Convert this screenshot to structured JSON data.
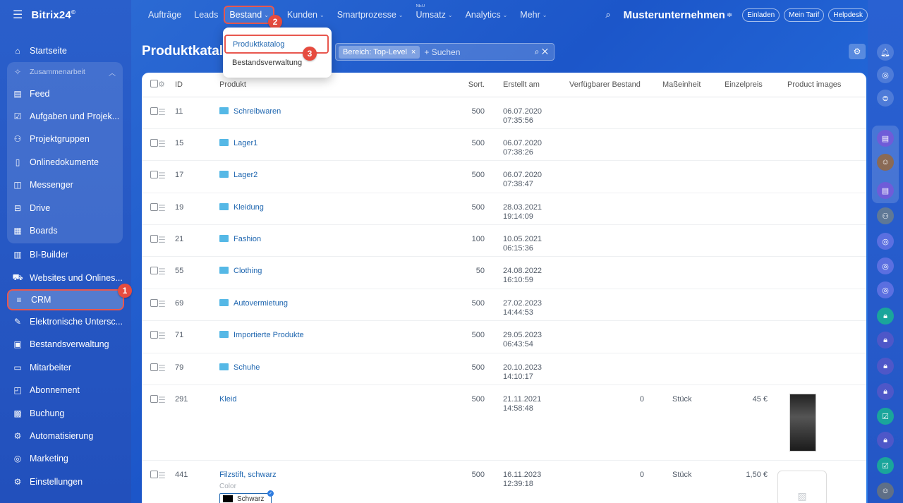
{
  "app": {
    "brand": "Bitrix24",
    "brand_mark": "©"
  },
  "topnav": {
    "tabs": [
      {
        "label": "Aufträge"
      },
      {
        "label": "Leads"
      },
      {
        "label": "Bestand",
        "chevron": "⌄"
      },
      {
        "label": "Kunden",
        "chevron": "⌄"
      },
      {
        "label": "Smartprozesse",
        "chevron": "⌄"
      },
      {
        "label": "Umsatz",
        "chevron": "⌄",
        "badge": "NEU"
      },
      {
        "label": "Analytics",
        "chevron": "⌄"
      },
      {
        "label": "Mehr",
        "chevron": "⌄"
      }
    ],
    "company": "Musterunternehmen",
    "invite": "Einladen",
    "plan": "Mein Tarif",
    "help": "Helpdesk"
  },
  "dropdown": {
    "items": [
      "Produktkatalog",
      "Bestandsverwaltung"
    ]
  },
  "markers": {
    "m1": "1",
    "m2": "2",
    "m3": "3"
  },
  "sidebar": {
    "home": "Startseite",
    "group_label": "Zusammenarbeit",
    "group_items": [
      "Feed",
      "Aufgaben und Projek...",
      "Projektgruppen",
      "Onlinedokumente",
      "Messenger",
      "Drive",
      "Boards"
    ],
    "items": [
      "BI-Builder",
      "Websites und Onlines...",
      "CRM",
      "Elektronische Untersc...",
      "Bestandsverwaltung",
      "Mitarbeiter",
      "Abonnement",
      "Buchung",
      "Automatisierung",
      "Marketing",
      "Einstellungen"
    ]
  },
  "page": {
    "title": "Produktkatalog",
    "filter_chip": "Bereich: Top-Level",
    "search_placeholder": "+ Suchen"
  },
  "table": {
    "columns": [
      "ID",
      "Produkt",
      "Sort.",
      "Erstellt am",
      "Verfügbarer Bestand",
      "Maßeinheit",
      "Einzelpreis",
      "Product images"
    ],
    "rows": [
      {
        "id": "11",
        "name": "Schreibwaren",
        "folder": true,
        "sort": "500",
        "date": "06.07.2020",
        "time": "07:35:56",
        "stock": "",
        "unit": "",
        "price": ""
      },
      {
        "id": "15",
        "name": "Lager1",
        "folder": true,
        "sort": "500",
        "date": "06.07.2020",
        "time": "07:38:26",
        "stock": "",
        "unit": "",
        "price": ""
      },
      {
        "id": "17",
        "name": "Lager2",
        "folder": true,
        "sort": "500",
        "date": "06.07.2020",
        "time": "07:38:47",
        "stock": "",
        "unit": "",
        "price": ""
      },
      {
        "id": "19",
        "name": "Kleidung",
        "folder": true,
        "sort": "500",
        "date": "28.03.2021",
        "time": "19:14:09",
        "stock": "",
        "unit": "",
        "price": ""
      },
      {
        "id": "21",
        "name": "Fashion",
        "folder": true,
        "sort": "100",
        "date": "10.05.2021",
        "time": "06:15:36",
        "stock": "",
        "unit": "",
        "price": ""
      },
      {
        "id": "55",
        "name": "Clothing",
        "folder": true,
        "sort": "50",
        "date": "24.08.2022",
        "time": "16:10:59",
        "stock": "",
        "unit": "",
        "price": ""
      },
      {
        "id": "69",
        "name": "Autovermietung",
        "folder": true,
        "sort": "500",
        "date": "27.02.2023",
        "time": "14:44:53",
        "stock": "",
        "unit": "",
        "price": ""
      },
      {
        "id": "71",
        "name": "Importierte Produkte",
        "folder": true,
        "sort": "500",
        "date": "29.05.2023",
        "time": "06:43:54",
        "stock": "",
        "unit": "",
        "price": ""
      },
      {
        "id": "79",
        "name": "Schuhe",
        "folder": true,
        "sort": "500",
        "date": "20.10.2023",
        "time": "14:10:17",
        "stock": "",
        "unit": "",
        "price": ""
      },
      {
        "id": "291",
        "name": "Kleid",
        "folder": false,
        "sort": "500",
        "date": "21.11.2021",
        "time": "14:58:48",
        "stock": "0",
        "unit": "Stück",
        "price": "45 €"
      },
      {
        "id": "441",
        "name": "Filzstift, schwarz",
        "folder": false,
        "sort": "500",
        "date": "16.11.2023",
        "time": "12:39:18",
        "stock": "0",
        "unit": "Stück",
        "price": "1,50 €",
        "prop_label": "Color",
        "prop_value": "Schwarz"
      }
    ]
  }
}
